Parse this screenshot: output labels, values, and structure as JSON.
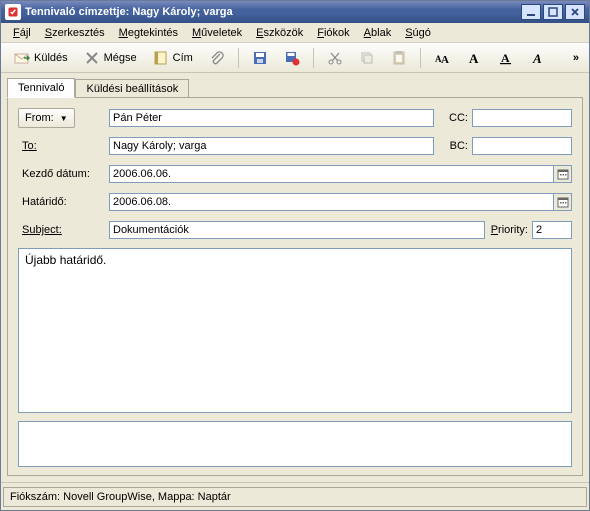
{
  "window": {
    "title": "Tennivaló címzettje: Nagy Károly; varga"
  },
  "menu": {
    "file": "Fájl",
    "edit": "Szerkesztés",
    "view": "Megtekintés",
    "actions": "Műveletek",
    "tools": "Eszközök",
    "accounts": "Fiókok",
    "window": "Ablak",
    "help": "Súgó"
  },
  "toolbar": {
    "send": "Küldés",
    "cancel": "Mégse",
    "address": "Cím"
  },
  "tabs": {
    "task": "Tennivaló",
    "sendoptions": "Küldési beállítások"
  },
  "labels": {
    "from": "From:",
    "to": "To:",
    "cc": "CC:",
    "bc": "BC:",
    "startdate": "Kezdő dátum:",
    "duedate": "Határidő:",
    "subject": "Subject:",
    "priority": "Priority:"
  },
  "values": {
    "from": "Pán Péter",
    "to": "Nagy Károly; varga",
    "cc": "",
    "bc": "",
    "startdate": "2006.06.06.",
    "duedate": "2006.06.08.",
    "subject": "Dokumentációk",
    "priority": "2",
    "body": "Újabb határidő."
  },
  "status": {
    "text": "Fiókszám: Novell GroupWise,  Mappa: Naptár"
  }
}
